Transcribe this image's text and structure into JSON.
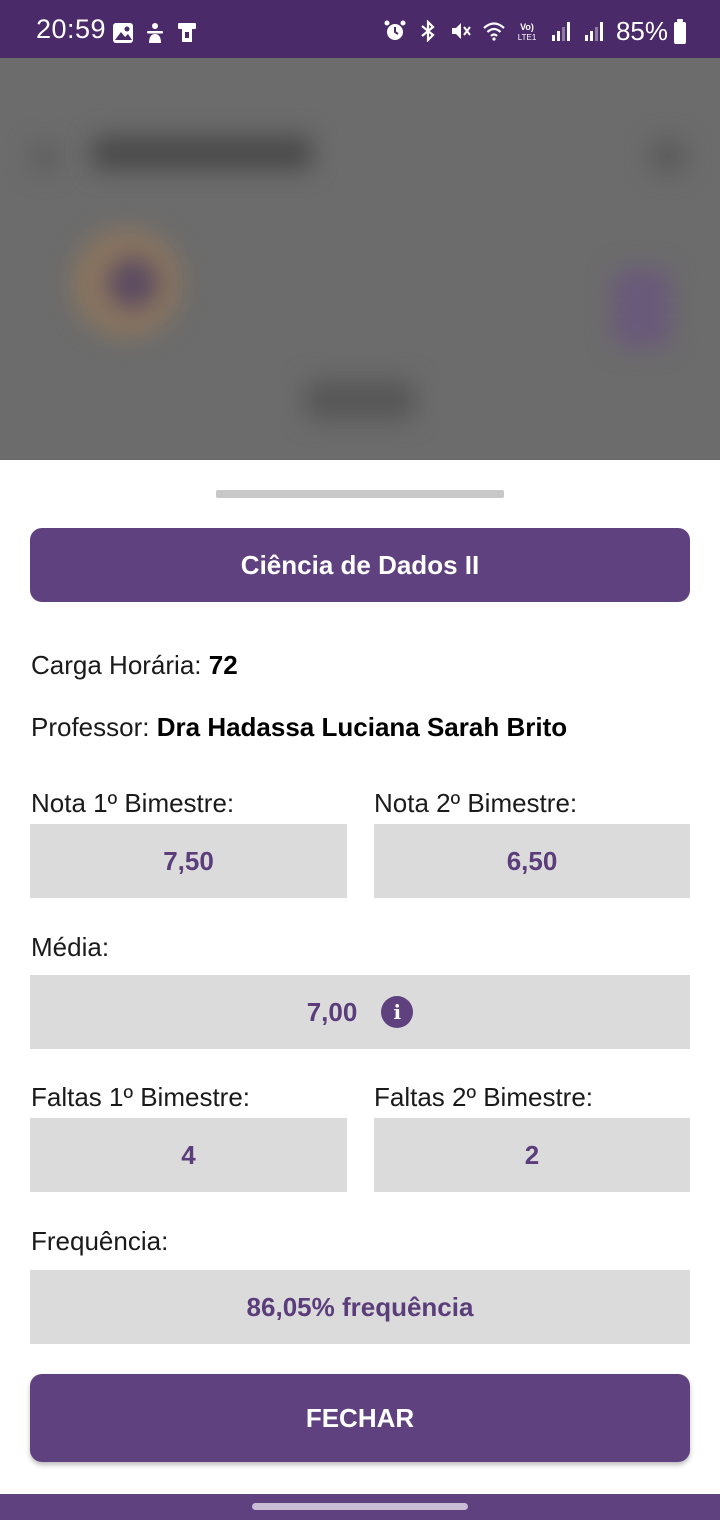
{
  "status_bar": {
    "time": "20:59",
    "battery": "85%",
    "left_icons": [
      "gallery-icon",
      "accessibility-icon",
      "card-icon"
    ],
    "right_icons": [
      "alarm-icon",
      "bluetooth-icon",
      "mute-icon",
      "wifi-icon",
      "volte-icon",
      "signal-icon",
      "signal-icon"
    ]
  },
  "sheet": {
    "title": "Ciência de Dados II",
    "workload_label": "Carga Horária:",
    "workload_value": "72",
    "professor_label": "Professor:",
    "professor_value": "Dra Hadassa Luciana Sarah Brito",
    "grade1_label": "Nota 1º Bimestre:",
    "grade1_value": "7,50",
    "grade2_label": "Nota 2º Bimestre:",
    "grade2_value": "6,50",
    "average_label": "Média:",
    "average_value": "7,00",
    "absences1_label": "Faltas 1º Bimestre:",
    "absences1_value": "4",
    "absences2_label": "Faltas 2º Bimestre:",
    "absences2_value": "2",
    "frequency_label": "Frequência:",
    "frequency_value": "86,05% frequência",
    "close_label": "FECHAR"
  },
  "colors": {
    "primary": "#5f4180",
    "status_bar": "#4b2a6a",
    "field_bg": "#dcdbdb",
    "field_text": "#5a3d7a"
  }
}
